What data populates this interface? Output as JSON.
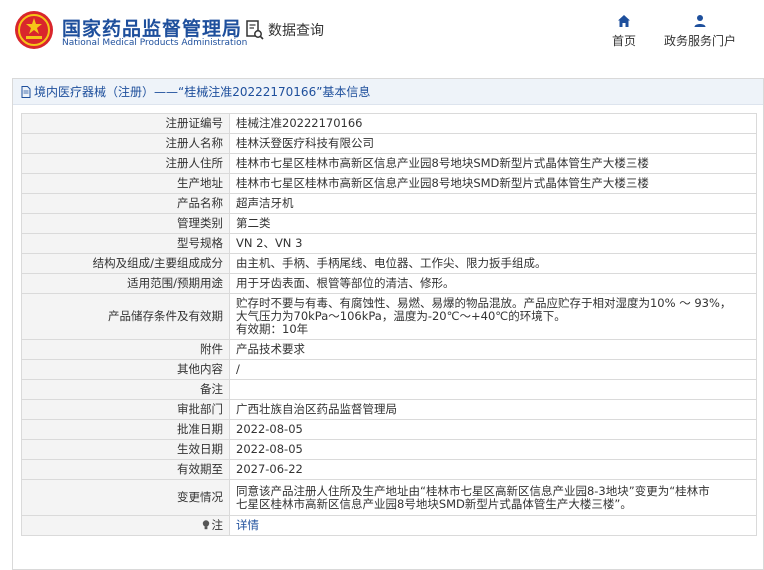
{
  "header": {
    "brand_cn": "国家药品监督管理局",
    "brand_en": "National Medical Products Administration",
    "query_label": "数据查询",
    "nav": [
      {
        "label": "首页",
        "icon": "home-icon"
      },
      {
        "label": "政务服务门户",
        "icon": "user-icon"
      }
    ]
  },
  "panel": {
    "title": "境内医疗器械（注册）——“桂械注准20222170166”基本信息"
  },
  "rows": [
    {
      "label": "注册证编号",
      "value": "桂械注准20222170166"
    },
    {
      "label": "注册人名称",
      "value": "桂林沃登医疗科技有限公司"
    },
    {
      "label": "注册人住所",
      "value": "桂林市七星区桂林市高新区信息产业园8号地块SMD新型片式晶体管生产大楼三楼"
    },
    {
      "label": "生产地址",
      "value": "桂林市七星区桂林市高新区信息产业园8号地块SMD新型片式晶体管生产大楼三楼"
    },
    {
      "label": "产品名称",
      "value": "超声洁牙机"
    },
    {
      "label": "管理类别",
      "value": "第二类"
    },
    {
      "label": "型号规格",
      "value": "VN 2、VN 3"
    },
    {
      "label": "结构及组成/主要组成成分",
      "value": "由主机、手柄、手柄尾线、电位器、工作尖、限力扳手组成。"
    },
    {
      "label": "适用范围/预期用途",
      "value": "用于牙齿表面、根管等部位的清洁、修形。"
    },
    {
      "label": "产品储存条件及有效期",
      "value_lines": [
        "贮存时不要与有毒、有腐蚀性、易燃、易爆的物品混放。产品应贮存于相对湿度为10% ～ 93%，",
        "大气压力为70kPa～106kPa，温度为-20℃～+40℃的环境下。",
        "有效期：10年"
      ]
    },
    {
      "label": "附件",
      "value": "产品技术要求"
    },
    {
      "label": "其他内容",
      "value": "/"
    },
    {
      "label": "备注",
      "value": ""
    },
    {
      "label": "审批部门",
      "value": "广西壮族自治区药品监督管理局"
    },
    {
      "label": "批准日期",
      "value": "2022-08-05"
    },
    {
      "label": "生效日期",
      "value": "2022-08-05"
    },
    {
      "label": "有效期至",
      "value": "2027-06-22"
    },
    {
      "label": "变更情况",
      "value_lines": [
        "同意该产品注册人住所及生产地址由“桂林市七星区高新区信息产业园8-3地块”变更为“桂林市",
        "七星区桂林市高新区信息产业园8号地块SMD新型片式晶体管生产大楼三楼”。"
      ]
    },
    {
      "label": "注",
      "value": "详情"
    }
  ],
  "colors": {
    "brand_blue": "#1e4f9c",
    "label_bg": "#f4f4f4",
    "panel_head_bg": "#eef3f9"
  }
}
